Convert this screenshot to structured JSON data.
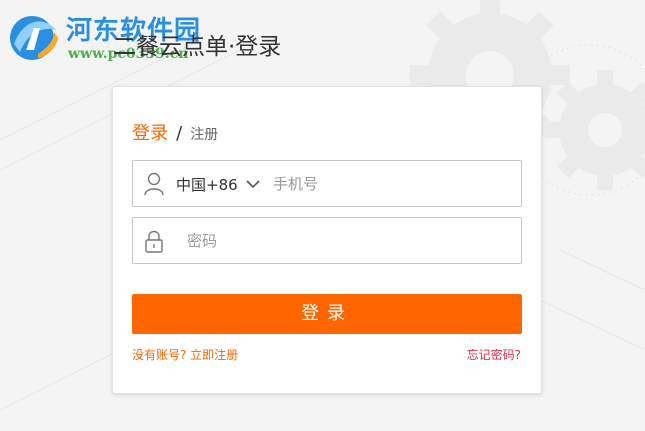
{
  "watermark": {
    "title": "河东软件园",
    "url": "www.pc0359.cn"
  },
  "page": {
    "title": "二餐云点单·登录"
  },
  "tabs": {
    "login": "登录",
    "separator": "/",
    "register": "注册"
  },
  "phone_field": {
    "country_code": "中国+86",
    "placeholder": "手机号",
    "icon": "user-icon"
  },
  "password_field": {
    "placeholder": "密码",
    "icon": "lock-icon"
  },
  "login_button": {
    "label": "登录"
  },
  "links": {
    "register": "没有账号? 立即注册",
    "forgot": "忘记密码?"
  },
  "colors": {
    "accent": "#ff6600",
    "forgot_link": "#e0314b",
    "watermark_blue": "#2a8fe0",
    "watermark_green": "#4caf50"
  }
}
